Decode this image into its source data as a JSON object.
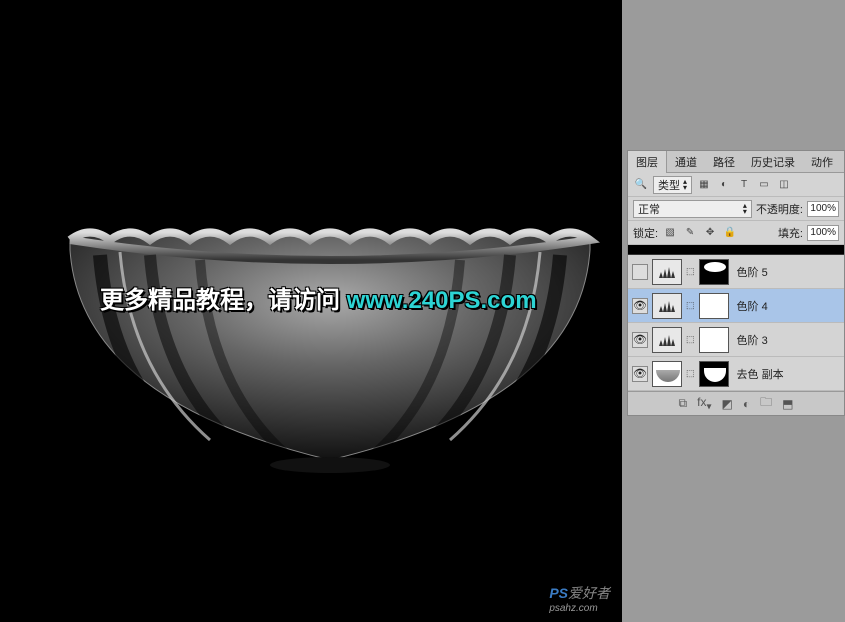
{
  "overlay": {
    "text_part1": "更多精品教程，请访问 ",
    "text_part2": "www.240PS.com"
  },
  "watermark": {
    "prefix": "PS",
    "suffix": "爱好者",
    "domain": "psahz.com"
  },
  "panel": {
    "tabs": {
      "layers": "图层",
      "channels": "通道",
      "paths": "路径",
      "history": "历史记录",
      "actions": "动作"
    },
    "filter_label": "类型",
    "blend_mode": "正常",
    "opacity_label": "不透明度:",
    "opacity_value": "100%",
    "lock_label": "锁定:",
    "fill_label": "填充:",
    "fill_value": "100%",
    "layers": [
      {
        "name": "色阶 5",
        "visible": false,
        "type": "levels",
        "mask": "shape-top",
        "selected": false
      },
      {
        "name": "色阶 4",
        "visible": true,
        "type": "levels",
        "mask": "white",
        "selected": true
      },
      {
        "name": "色阶 3",
        "visible": true,
        "type": "levels",
        "mask": "white",
        "selected": false
      },
      {
        "name": "去色 副本",
        "visible": true,
        "type": "image",
        "mask": "shape",
        "selected": false
      }
    ]
  }
}
